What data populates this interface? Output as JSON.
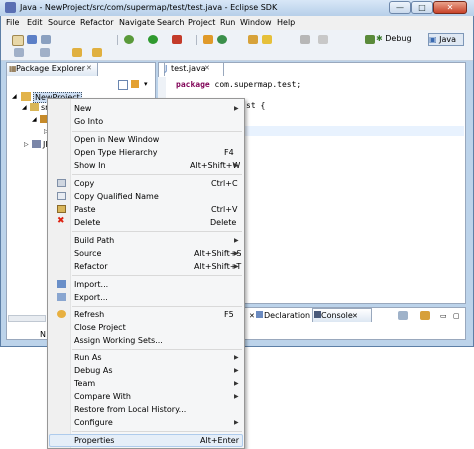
{
  "window": {
    "title": "Java - NewProject/src/com/supermap/test/test.java - Eclipse SDK",
    "controls": {
      "minimize": "—",
      "maximize": "□",
      "close": "✕"
    }
  },
  "menubar": [
    "File",
    "Edit",
    "Source",
    "Refactor",
    "Navigate",
    "Search",
    "Project",
    "Run",
    "Window",
    "Help"
  ],
  "perspectives": {
    "debug": "Debug",
    "java": "Java"
  },
  "package_explorer": {
    "title": "Package Explorer",
    "close": "✕",
    "tree": {
      "project": "NewProject",
      "src": "src",
      "jre": "JR",
      "bottom_label": "N"
    }
  },
  "editor": {
    "tab": "test.java",
    "close": "✕",
    "line1_kw": "package",
    "line1_rest": "com.supermap.test;",
    "line2": "st {"
  },
  "bottom_views": {
    "declaration": "Declaration",
    "console": "Console",
    "close": "✕"
  },
  "context_menu": {
    "new": "New",
    "go_into": "Go Into",
    "open_new_window": "Open in New Window",
    "open_type_hierarchy": "Open Type Hierarchy",
    "open_type_hierarchy_acc": "F4",
    "show_in": "Show In",
    "show_in_acc": "Alt+Shift+W",
    "copy": "Copy",
    "copy_acc": "Ctrl+C",
    "copy_qualified": "Copy Qualified Name",
    "paste": "Paste",
    "paste_acc": "Ctrl+V",
    "delete": "Delete",
    "delete_acc": "Delete",
    "build_path": "Build Path",
    "source": "Source",
    "source_acc": "Alt+Shift+S",
    "refactor": "Refactor",
    "refactor_acc": "Alt+Shift+T",
    "import": "Import...",
    "export": "Export...",
    "refresh": "Refresh",
    "refresh_acc": "F5",
    "close_project": "Close Project",
    "assign_working_sets": "Assign Working Sets...",
    "run_as": "Run As",
    "debug_as": "Debug As",
    "team": "Team",
    "compare_with": "Compare With",
    "restore_history": "Restore from Local History...",
    "configure": "Configure",
    "properties": "Properties",
    "properties_acc": "Alt+Enter",
    "arrow": "▶"
  },
  "colors": {
    "titlebar": "#b7cfe9",
    "keyword": "#7f0055",
    "menu_highlight": "#e5eef8",
    "delete_icon": "#dd2211"
  }
}
